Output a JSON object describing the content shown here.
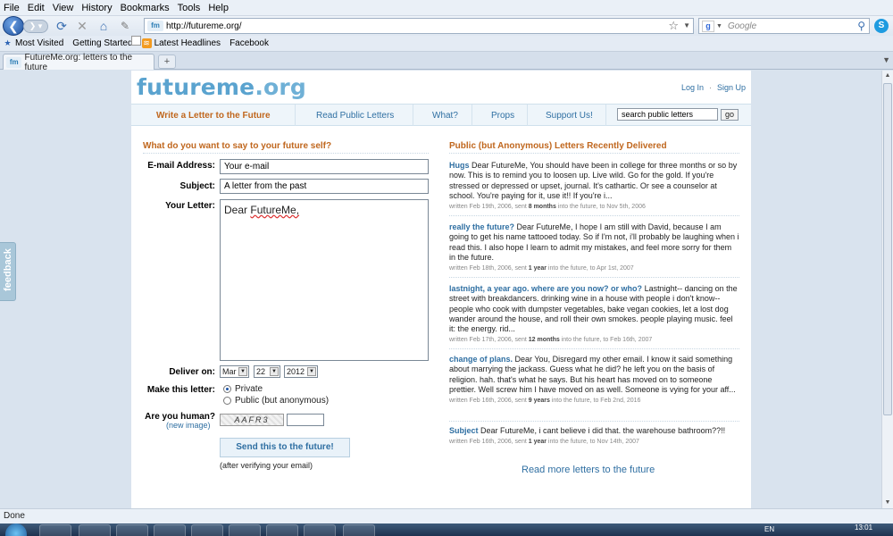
{
  "browser": {
    "menu": [
      "File",
      "Edit",
      "View",
      "History",
      "Bookmarks",
      "Tools",
      "Help"
    ],
    "url": "http://futureme.org/",
    "search_placeholder": "Google",
    "bookmarks": [
      "Most Visited",
      "Getting Started",
      "Latest Headlines",
      "Facebook"
    ],
    "tab_title": "FutureMe.org: letters to the future",
    "status": "Done"
  },
  "site": {
    "logo_main": "futureme",
    "logo_tld": ".org",
    "login": "Log In",
    "signup": "Sign Up",
    "nav": {
      "write": "Write a Letter to the Future",
      "read": "Read Public Letters",
      "what": "What?",
      "props": "Props",
      "support": "Support Us!",
      "search_value": "search public letters",
      "go": "go"
    },
    "feedback": "feedback"
  },
  "form": {
    "heading": "What do you want to say to your future self?",
    "email_label": "E-mail Address:",
    "email_value": "Your e-mail",
    "subject_label": "Subject:",
    "subject_value": "A letter from the past",
    "letter_label": "Your Letter:",
    "letter_dear": "Dear",
    "letter_name": "FutureMe,",
    "deliver_label": "Deliver on:",
    "month": "Mar",
    "day": "22",
    "year": "2012",
    "make_label": "Make this letter:",
    "private": "Private",
    "public": "Public (but anonymous)",
    "human_label": "Are you human?",
    "new_image": "(new image)",
    "captcha": "AAFR3",
    "send": "Send this to the future!",
    "after": "(after verifying your email)"
  },
  "letters": {
    "heading": "Public (but Anonymous) Letters Recently Delivered",
    "items": [
      {
        "title": "Hugs",
        "text": "Dear FutureMe, You should have been in college for three months or so by now. This is to remind you to loosen up. Live wild. Go for the gold. If you're stressed or depressed or upset, journal. It's cathartic. Or see a counselor at school. You're paying for it, use it!! If you're i...",
        "meta_a": "written Feb 19th, 2006, sent ",
        "meta_b": "8 months",
        "meta_c": " into the future, to Nov 5th, 2006"
      },
      {
        "title": "really the future?",
        "text": "Dear FutureMe, I hope I am still with David, because I am going to get his name tattooed today. So if I'm not, i'll probably be laughing when i read this. I also hope I learn to admit my mistakes, and feel more sorry for them in the future.",
        "meta_a": "written Feb 18th, 2006, sent ",
        "meta_b": "1 year",
        "meta_c": " into the future, to Apr 1st, 2007"
      },
      {
        "title": "lastnight, a year ago. where are you now? or who?",
        "text": "Lastnight-- dancing on the street with breakdancers. drinking wine in a house with people i don't know-- people who cook with dumpster vegetables, bake vegan cookies, let a lost dog wander around the house, and roll their own smokes. people playing music. feel it: the energy. rid...",
        "meta_a": "written Feb 17th, 2006, sent ",
        "meta_b": "12 months",
        "meta_c": " into the future, to Feb 16th, 2007"
      },
      {
        "title": "change of plans.",
        "text": "Dear You, Disregard my other email. I know it said something about marrying the jackass. Guess what he did? he left you on the basis of religion. hah. that's what he says. But his heart has moved on to someone prettier. Well screw him I have moved on as well. Someone is vying for your aff...",
        "meta_a": "written Feb 16th, 2006, sent ",
        "meta_b": "9 years",
        "meta_c": " into the future, to Feb 2nd, 2016"
      },
      {
        "title": "Subject",
        "text": "Dear FutureMe, i cant believe i did that. the warehouse bathroom??!!",
        "meta_a": "written Feb 16th, 2006, sent ",
        "meta_b": "1 year",
        "meta_c": " into the future, to Nov 14th, 2007"
      }
    ],
    "read_more": "Read more letters to the future"
  },
  "taskbar": {
    "lang": "EN",
    "time": "13:01"
  }
}
